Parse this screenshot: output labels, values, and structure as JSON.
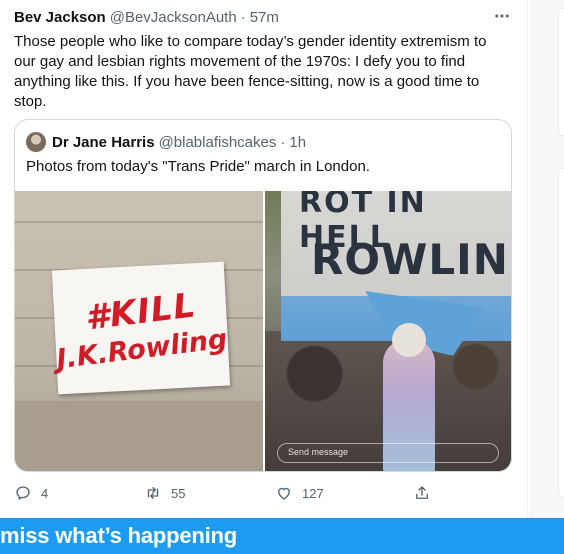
{
  "tweet": {
    "author_name": "Bev Jackson",
    "author_handle": "@BevJacksonAuth",
    "separator": "·",
    "time": "57m",
    "more_icon": "more-horizontal-icon",
    "text": "Those people who like to compare today’s gender identity extremism to our gay and lesbian rights movement of the 1970s: I defy you to find anything like this. If you have been fence-sitting, now is a good time to stop."
  },
  "quote": {
    "author_name": "Dr Jane Harris",
    "author_handle": "@blablafishcakes",
    "separator": "·",
    "time": "1h",
    "text": "Photos from today's \"Trans Pride\" march in London.",
    "photos": [
      {
        "sign_text_line1": "#KILL",
        "sign_text_line2": "J.K.Rowling"
      },
      {
        "sign_text_line1": "ROT IN HELL",
        "sign_text_line2": "ROWLING",
        "overlay_text": "Send message"
      }
    ]
  },
  "actions": {
    "reply": {
      "icon": "reply-icon",
      "count": "4"
    },
    "retweet": {
      "icon": "retweet-icon",
      "count": "55"
    },
    "like": {
      "icon": "heart-icon",
      "count": "127"
    },
    "share": {
      "icon": "share-icon"
    }
  },
  "banner": {
    "text": "miss what’s happening"
  },
  "colors": {
    "accent": "#1d9bf0",
    "text_primary": "#0f1419",
    "text_secondary": "#536471",
    "border": "#cfd9de",
    "sign_red": "#d01c26"
  }
}
